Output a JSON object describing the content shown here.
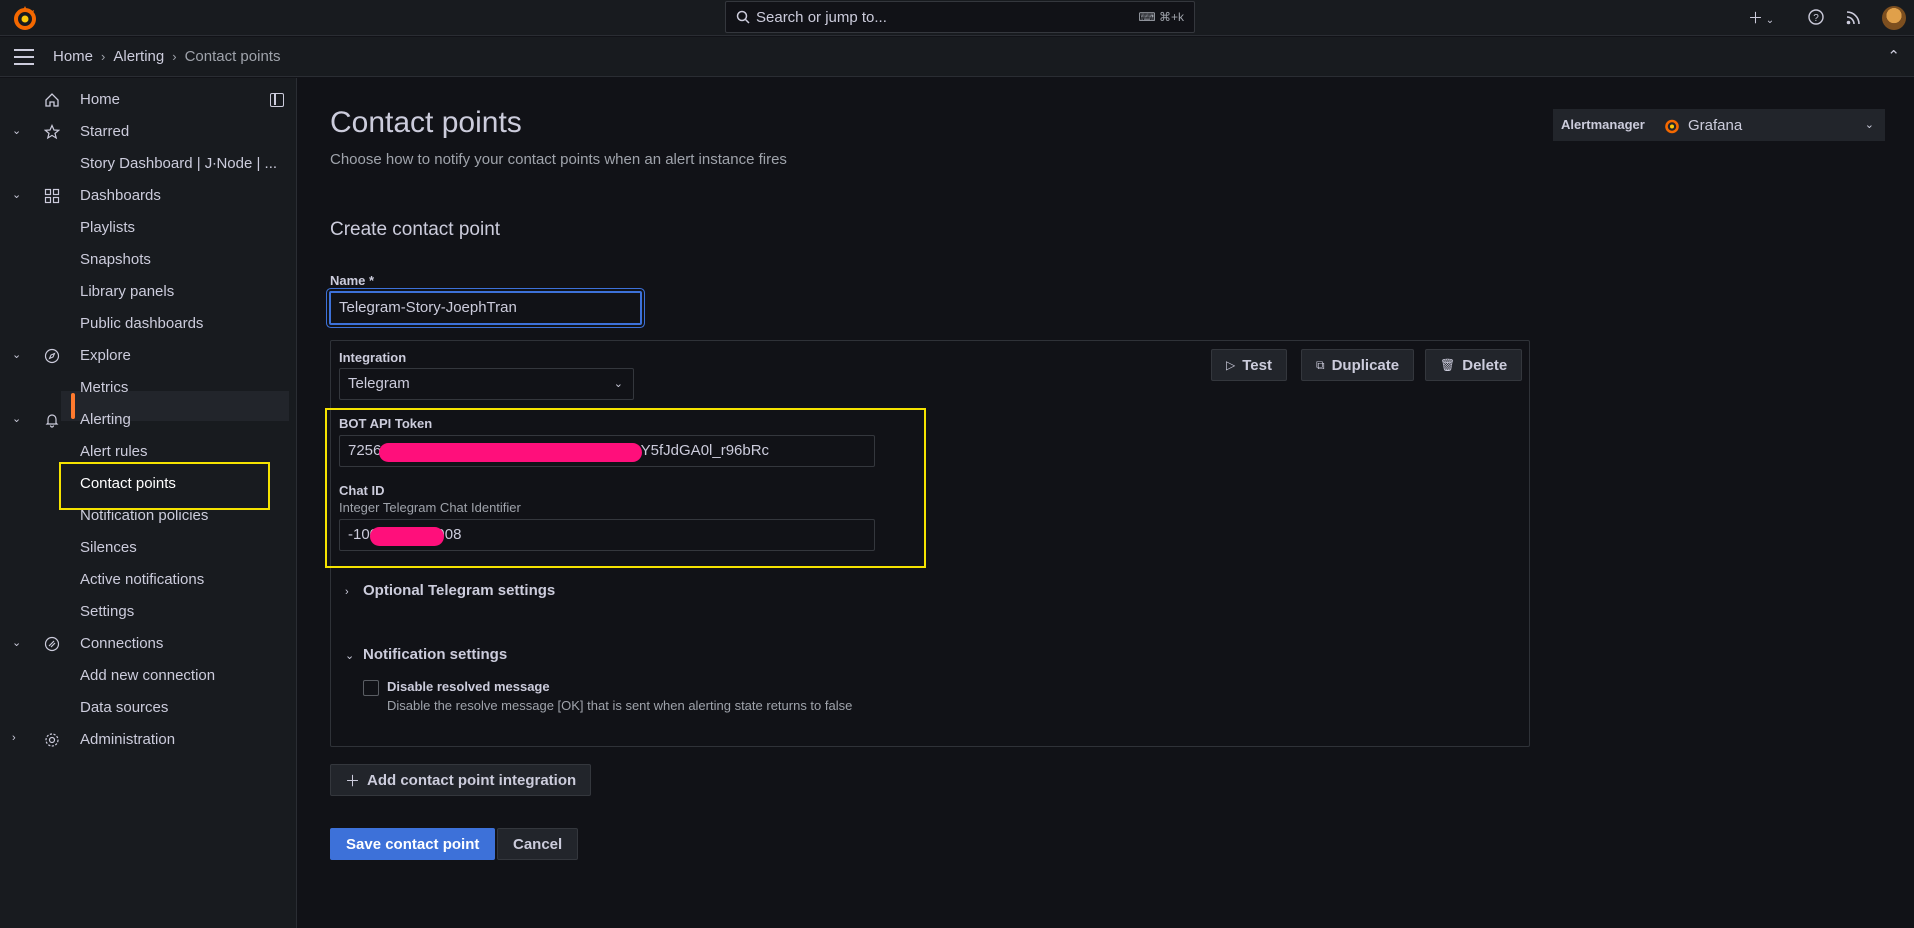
{
  "topbar": {
    "search_placeholder": "Search or jump to...",
    "search_shortcut": "⌘+k",
    "new_icon": "plus-icon",
    "help_icon": "help-icon",
    "news_icon": "rss-icon"
  },
  "breadcrumb": {
    "items": [
      "Home",
      "Alerting",
      "Contact points"
    ]
  },
  "sidebar": {
    "items": [
      {
        "label": "Home",
        "icon": "home-icon"
      },
      {
        "label": "Starred",
        "icon": "star-icon"
      },
      {
        "label": "Story Dashboard | J∙Node | ..."
      },
      {
        "label": "Dashboards",
        "icon": "apps-icon"
      },
      {
        "label": "Playlists"
      },
      {
        "label": "Snapshots"
      },
      {
        "label": "Library panels"
      },
      {
        "label": "Public dashboards"
      },
      {
        "label": "Explore",
        "icon": "compass-icon"
      },
      {
        "label": "Metrics"
      },
      {
        "label": "Alerting",
        "icon": "bell-icon"
      },
      {
        "label": "Alert rules"
      },
      {
        "label": "Contact points"
      },
      {
        "label": "Notification policies"
      },
      {
        "label": "Silences"
      },
      {
        "label": "Active notifications"
      },
      {
        "label": "Settings"
      },
      {
        "label": "Connections",
        "icon": "connections-icon"
      },
      {
        "label": "Add new connection"
      },
      {
        "label": "Data sources"
      },
      {
        "label": "Administration",
        "icon": "cog-icon"
      }
    ]
  },
  "main": {
    "title": "Contact points",
    "subtitle": "Choose how to notify your contact points when an alert instance fires",
    "alertmanager_label": "Alertmanager",
    "alertmanager_value": "Grafana",
    "form_title": "Create contact point",
    "name_label": "Name *",
    "name_value": "Telegram-Story-JoephTran",
    "integration_label": "Integration",
    "integration_value": "Telegram",
    "test_label": "Test",
    "duplicate_label": "Duplicate",
    "delete_label": "Delete",
    "bot_token_label": "BOT API Token",
    "bot_token_value": "7256260977:AAH3kPqR8mWx9LzTbVnC2sY5fJdGA0l_r96bRc",
    "chat_id_label": "Chat ID",
    "chat_id_desc": "Integer Telegram Chat Identifier",
    "chat_id_value": "-1002345678908",
    "optional_settings_label": "Optional Telegram settings",
    "notification_settings_label": "Notification settings",
    "disable_resolved_label": "Disable resolved message",
    "disable_resolved_desc": "Disable the resolve message [OK] that is sent when alerting state returns to false",
    "add_integration_label": "Add contact point integration",
    "save_label": "Save contact point",
    "cancel_label": "Cancel"
  },
  "colors": {
    "accent": "#3d71d9",
    "active_nav": "#ff7a2e",
    "highlight": "#f5e300",
    "redaction": "#ff0f7b"
  }
}
